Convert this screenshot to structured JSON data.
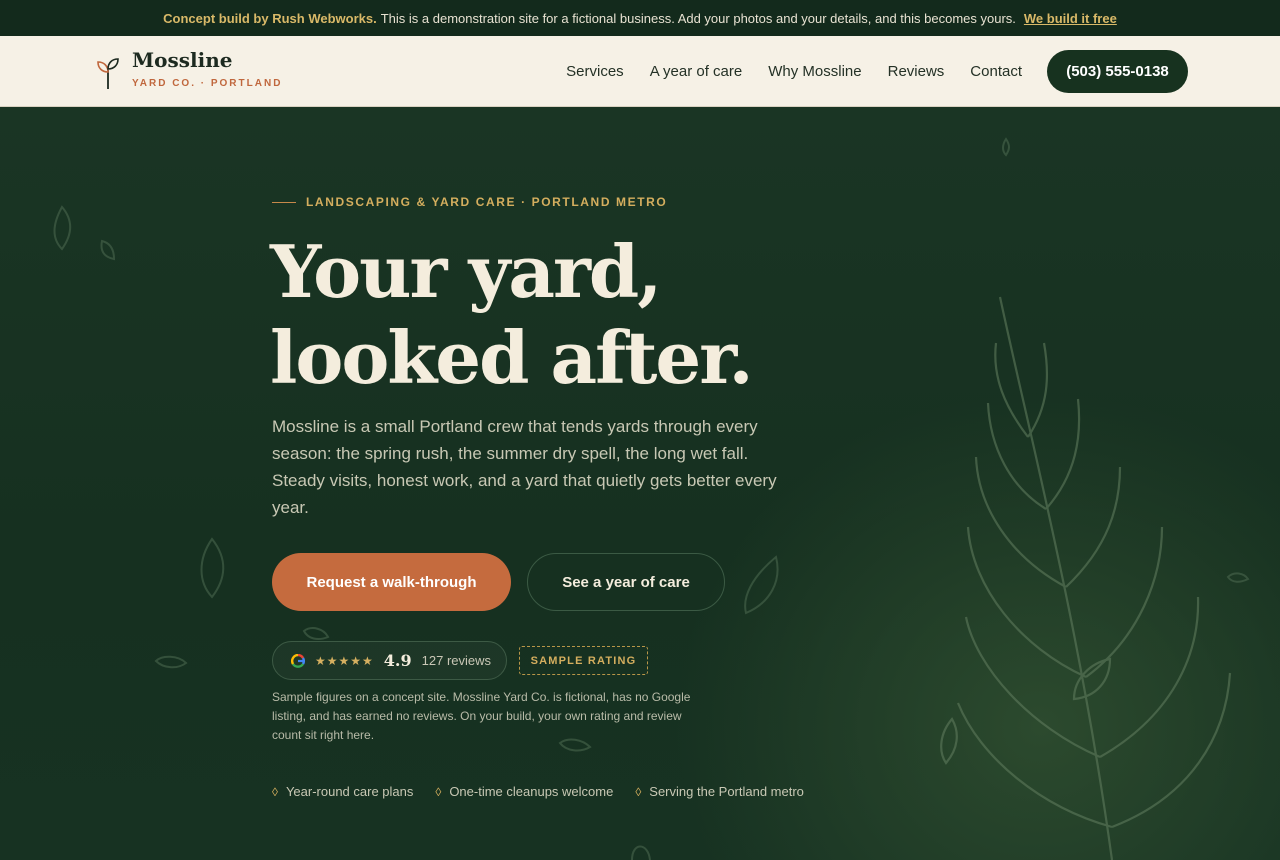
{
  "banner": {
    "brand": "Concept build by Rush Webworks.",
    "message": "This is a demonstration site for a fictional business. Add your photos and your details, and this becomes yours.",
    "link": "We build it free"
  },
  "nav": {
    "logo_name": "Mossline",
    "logo_sub": "YARD CO. · PORTLAND",
    "links": [
      "Services",
      "A year of care",
      "Why Mossline",
      "Reviews",
      "Contact"
    ],
    "phone": "(503) 555-0138"
  },
  "hero": {
    "eyebrow": "LANDSCAPING & YARD CARE · PORTLAND METRO",
    "title": "Your yard, looked after.",
    "lede": "Mossline is a small Portland crew that tends yards through every season: the spring rush, the summer dry spell, the long wet fall. Steady visits, honest work, and a yard that quietly gets better every year.",
    "cta_primary": "Request a walk-through",
    "cta_secondary": "See a year of care",
    "rating": {
      "stars": "★★★★★",
      "score": "4.9",
      "reviews": "127 reviews",
      "badge": "SAMPLE RATING"
    },
    "note": "Sample figures on a concept site. Mossline Yard Co. is fictional, has no Google listing, and has earned no reviews. On your build, your own rating and review count sit right here.",
    "perks": [
      "Year-round care plans",
      "One-time cleanups welcome",
      "Serving the Portland metro"
    ]
  },
  "colors": {
    "accent": "#c56b3e",
    "gold": "#d4ae5e",
    "forest": "#17321f",
    "cream": "#f6f1e6"
  }
}
